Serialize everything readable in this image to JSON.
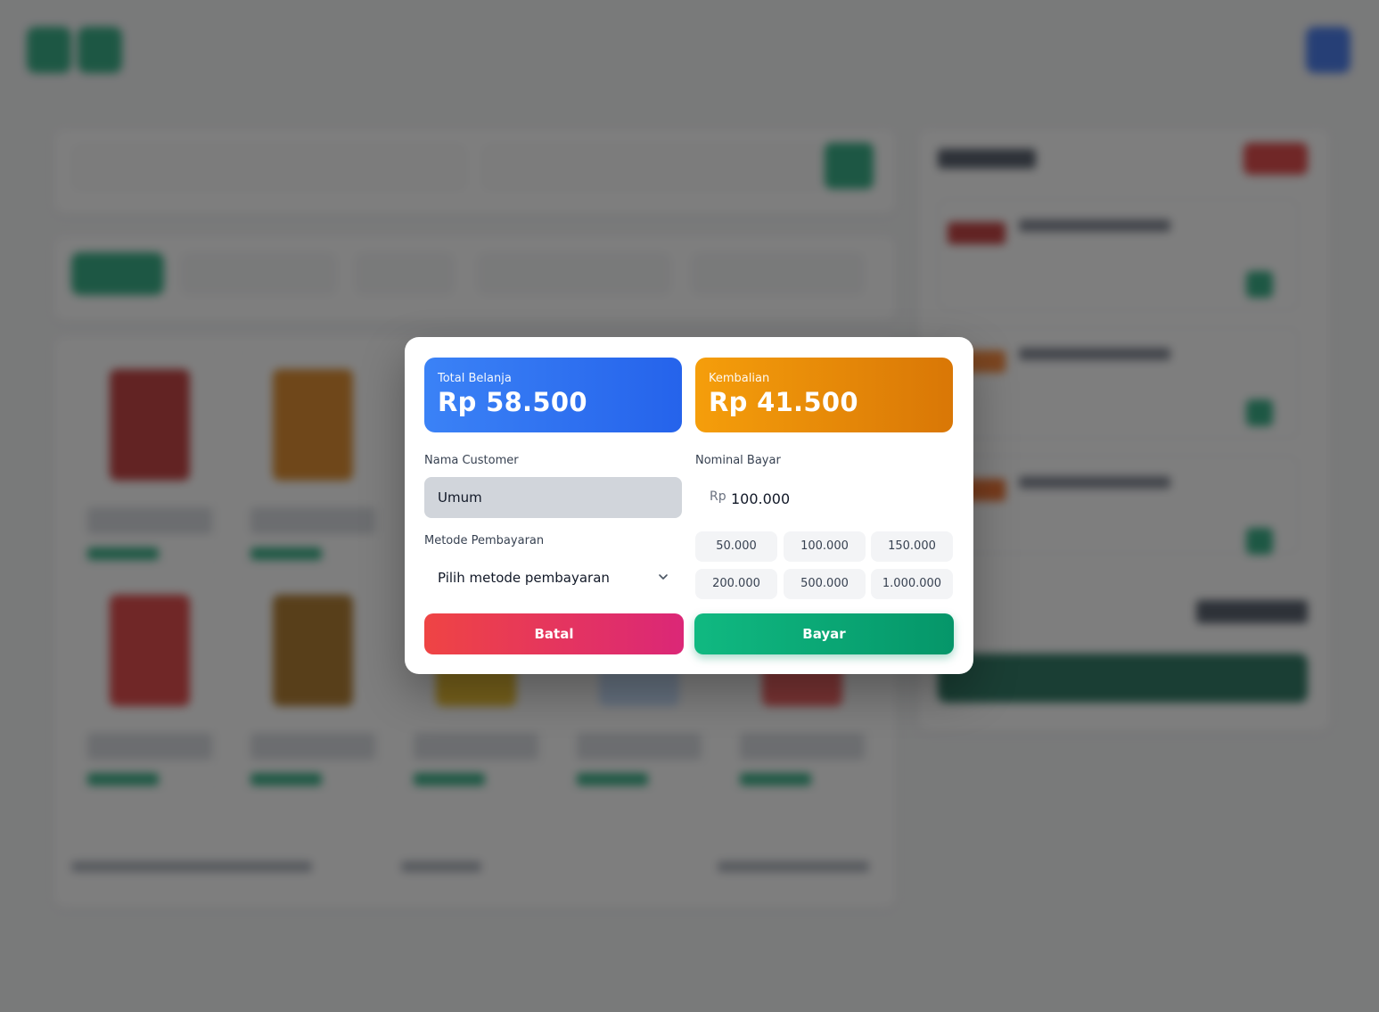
{
  "modal": {
    "total": {
      "label": "Total Belanja",
      "value": "Rp 58.500",
      "color": "#2563eb"
    },
    "change": {
      "label": "Kembalian",
      "value": "Rp 41.500",
      "color": "#d97706"
    },
    "customer": {
      "label": "Nama Customer",
      "value": "Umum"
    },
    "payment_amount": {
      "label": "Nominal Bayar",
      "prefix": "Rp",
      "value": "100.000"
    },
    "method": {
      "label": "Metode Pembayaran",
      "selected": "Pilih metode pembayaran",
      "icon": "chevron-down-icon"
    },
    "quick_amounts": [
      "50.000",
      "100.000",
      "150.000",
      "200.000",
      "500.000",
      "1.000.000"
    ],
    "cancel_label": "Batal",
    "pay_label": "Bayar"
  },
  "colors": {
    "brand_green": "#0e9f6e",
    "danger": "#ef4444",
    "primary": "#2563eb",
    "warning": "#d97706"
  }
}
